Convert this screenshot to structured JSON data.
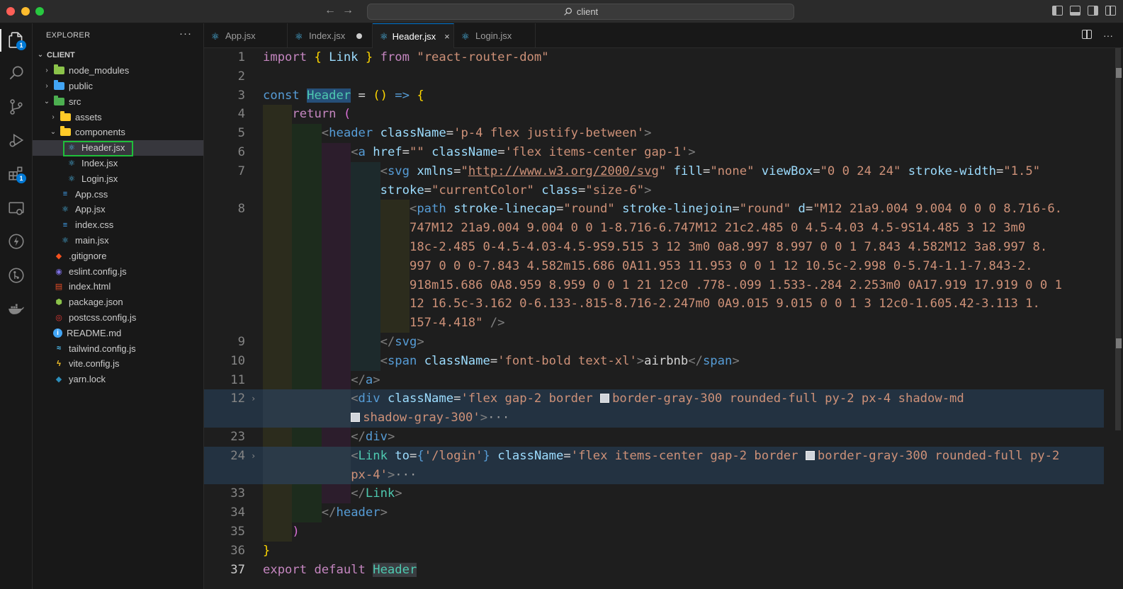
{
  "window": {
    "search_text": "client"
  },
  "sidebar": {
    "title": "EXPLORER",
    "more": "···",
    "root": "CLIENT",
    "items": [
      {
        "name": "node_modules",
        "type": "folder",
        "depth": 1,
        "chevron": "›"
      },
      {
        "name": "public",
        "type": "folder",
        "depth": 1,
        "chevron": "›"
      },
      {
        "name": "src",
        "type": "folder",
        "depth": 1,
        "chevron": "⌄"
      },
      {
        "name": "assets",
        "type": "folder",
        "depth": 2,
        "chevron": "›"
      },
      {
        "name": "components",
        "type": "folder",
        "depth": 2,
        "chevron": "⌄"
      },
      {
        "name": "Header.jsx",
        "type": "react",
        "depth": 3,
        "selected": true
      },
      {
        "name": "Index.jsx",
        "type": "react",
        "depth": 3
      },
      {
        "name": "Login.jsx",
        "type": "react",
        "depth": 3
      },
      {
        "name": "App.css",
        "type": "css",
        "depth": 2
      },
      {
        "name": "App.jsx",
        "type": "react",
        "depth": 2
      },
      {
        "name": "index.css",
        "type": "css",
        "depth": 2
      },
      {
        "name": "main.jsx",
        "type": "react",
        "depth": 2
      },
      {
        "name": ".gitignore",
        "type": "git",
        "depth": 1
      },
      {
        "name": "eslint.config.js",
        "type": "eslint",
        "depth": 1
      },
      {
        "name": "index.html",
        "type": "html",
        "depth": 1
      },
      {
        "name": "package.json",
        "type": "node",
        "depth": 1
      },
      {
        "name": "postcss.config.js",
        "type": "postcss",
        "depth": 1
      },
      {
        "name": "README.md",
        "type": "info",
        "depth": 1
      },
      {
        "name": "tailwind.config.js",
        "type": "tailwind",
        "depth": 1
      },
      {
        "name": "vite.config.js",
        "type": "vite",
        "depth": 1
      },
      {
        "name": "yarn.lock",
        "type": "yarn",
        "depth": 1
      }
    ]
  },
  "activity_badges": {
    "explorer": "1",
    "extensions": "1"
  },
  "tabs": [
    {
      "label": "App.jsx",
      "state": "normal"
    },
    {
      "label": "Index.jsx",
      "state": "modified"
    },
    {
      "label": "Header.jsx",
      "state": "active"
    },
    {
      "label": "Login.jsx",
      "state": "normal"
    }
  ],
  "tab_close_glyph": "×",
  "fold_glyph": "›",
  "code_lines": [
    {
      "n": "1",
      "tokens": [
        [
          "k",
          "import "
        ],
        [
          "br",
          "{ "
        ],
        [
          "v",
          "Link"
        ],
        [
          "br",
          " }"
        ],
        [
          "k",
          " from "
        ],
        [
          "s",
          "\"react-router-dom\""
        ]
      ]
    },
    {
      "n": "2",
      "tokens": []
    },
    {
      "n": "3",
      "tokens": [
        [
          "kb",
          "const "
        ],
        [
          "fn-hl",
          "Header"
        ],
        [
          "d",
          " = "
        ],
        [
          "br",
          "()"
        ],
        [
          "kb",
          " => "
        ],
        [
          "br",
          "{"
        ]
      ]
    },
    {
      "n": "4",
      "tokens": [
        [
          "d",
          "    "
        ],
        [
          "k",
          "return "
        ],
        [
          "br2",
          "("
        ]
      ]
    },
    {
      "n": "5",
      "tokens": [
        [
          "d",
          "        "
        ],
        [
          "p",
          "<"
        ],
        [
          "kb",
          "header "
        ],
        [
          "v",
          "className"
        ],
        [
          "d",
          "="
        ],
        [
          "s",
          "'p-4 flex justify-between'"
        ],
        [
          "p",
          ">"
        ]
      ]
    },
    {
      "n": "6",
      "tokens": [
        [
          "d",
          "            "
        ],
        [
          "p",
          "<"
        ],
        [
          "kb",
          "a "
        ],
        [
          "v",
          "href"
        ],
        [
          "d",
          "="
        ],
        [
          "s",
          "\"\" "
        ],
        [
          "v",
          "className"
        ],
        [
          "d",
          "="
        ],
        [
          "s",
          "'flex items-center gap-1'"
        ],
        [
          "p",
          ">"
        ]
      ]
    },
    {
      "n": "7",
      "tokens": [
        [
          "d",
          "                "
        ],
        [
          "p",
          "<"
        ],
        [
          "kb",
          "svg "
        ],
        [
          "v",
          "xmlns"
        ],
        [
          "d",
          "="
        ],
        [
          "s",
          "\""
        ],
        [
          "url",
          "http://www.w3.org/2000/svg"
        ],
        [
          "s",
          "\" "
        ],
        [
          "v",
          "fill"
        ],
        [
          "d",
          "="
        ],
        [
          "s",
          "\"none\" "
        ],
        [
          "v",
          "viewBox"
        ],
        [
          "d",
          "="
        ],
        [
          "s",
          "\"0 0 24 24\" "
        ],
        [
          "v",
          "stroke-width"
        ],
        [
          "d",
          "="
        ],
        [
          "s",
          "\"1.5\""
        ]
      ]
    },
    {
      "n": "",
      "tokens": [
        [
          "d",
          "                "
        ],
        [
          "v",
          "stroke"
        ],
        [
          "d",
          "="
        ],
        [
          "s",
          "\"currentColor\" "
        ],
        [
          "v",
          "class"
        ],
        [
          "d",
          "="
        ],
        [
          "s",
          "\"size-6\""
        ],
        [
          "p",
          ">"
        ]
      ]
    },
    {
      "n": "8",
      "tokens": [
        [
          "d",
          "                    "
        ],
        [
          "p",
          "<"
        ],
        [
          "kb",
          "path "
        ],
        [
          "v",
          "stroke-linecap"
        ],
        [
          "d",
          "="
        ],
        [
          "s",
          "\"round\" "
        ],
        [
          "v",
          "stroke-linejoin"
        ],
        [
          "d",
          "="
        ],
        [
          "s",
          "\"round\" "
        ],
        [
          "v",
          "d"
        ],
        [
          "d",
          "="
        ],
        [
          "s",
          "\"M12 21a9.004 9.004 0 0 0 8.716-6."
        ]
      ]
    },
    {
      "n": "",
      "tokens": [
        [
          "d",
          "                    "
        ],
        [
          "s",
          "747M12 21a9.004 9.004 0 0 1-8.716-6.747M12 21c2.485 0 4.5-4.03 4.5-9S14.485 3 12 3m0"
        ]
      ]
    },
    {
      "n": "",
      "tokens": [
        [
          "d",
          "                    "
        ],
        [
          "s",
          "18c-2.485 0-4.5-4.03-4.5-9S9.515 3 12 3m0 0a8.997 8.997 0 0 1 7.843 4.582M12 3a8.997 8."
        ]
      ]
    },
    {
      "n": "",
      "tokens": [
        [
          "d",
          "                    "
        ],
        [
          "s",
          "997 0 0 0-7.843 4.582m15.686 0A11.953 11.953 0 0 1 12 10.5c-2.998 0-5.74-1.1-7.843-2."
        ]
      ]
    },
    {
      "n": "",
      "tokens": [
        [
          "d",
          "                    "
        ],
        [
          "s",
          "918m15.686 0A8.959 8.959 0 0 1 21 12c0 .778-.099 1.533-.284 2.253m0 0A17.919 17.919 0 0 1"
        ]
      ]
    },
    {
      "n": "",
      "tokens": [
        [
          "d",
          "                    "
        ],
        [
          "s",
          "12 16.5c-3.162 0-6.133-.815-8.716-2.247m0 0A9.015 9.015 0 0 1 3 12c0-1.605.42-3.113 1."
        ]
      ]
    },
    {
      "n": "",
      "tokens": [
        [
          "d",
          "                    "
        ],
        [
          "s",
          "157-4.418\" "
        ],
        [
          "p",
          "/>"
        ]
      ]
    },
    {
      "n": "9",
      "tokens": [
        [
          "d",
          "                "
        ],
        [
          "p",
          "</"
        ],
        [
          "kb",
          "svg"
        ],
        [
          "p",
          ">"
        ]
      ]
    },
    {
      "n": "10",
      "tokens": [
        [
          "d",
          "                "
        ],
        [
          "p",
          "<"
        ],
        [
          "kb",
          "span "
        ],
        [
          "v",
          "className"
        ],
        [
          "d",
          "="
        ],
        [
          "s",
          "'font-bold text-xl'"
        ],
        [
          "p",
          ">"
        ],
        [
          "d",
          "airbnb"
        ],
        [
          "p",
          "</"
        ],
        [
          "kb",
          "span"
        ],
        [
          "p",
          ">"
        ]
      ]
    },
    {
      "n": "11",
      "tokens": [
        [
          "d",
          "            "
        ],
        [
          "p",
          "</"
        ],
        [
          "kb",
          "a"
        ],
        [
          "p",
          ">"
        ]
      ]
    },
    {
      "n": "12",
      "fold": true,
      "hl": true,
      "tokens": [
        [
          "d",
          "            "
        ],
        [
          "p",
          "<"
        ],
        [
          "kb",
          "div "
        ],
        [
          "v",
          "className"
        ],
        [
          "d",
          "="
        ],
        [
          "s",
          "'flex gap-2 border "
        ],
        [
          "sq",
          ""
        ],
        [
          "s",
          "border-gray-300 rounded-full py-2 px-4 shadow-md"
        ]
      ]
    },
    {
      "n": "",
      "hl": true,
      "tokens": [
        [
          "d",
          "            "
        ],
        [
          "sq",
          ""
        ],
        [
          "s",
          "shadow-gray-300'"
        ],
        [
          "p",
          ">"
        ],
        [
          "e",
          "···"
        ]
      ]
    },
    {
      "n": "23",
      "tokens": [
        [
          "d",
          "            "
        ],
        [
          "p",
          "</"
        ],
        [
          "kb",
          "div"
        ],
        [
          "p",
          ">"
        ]
      ]
    },
    {
      "n": "24",
      "fold": true,
      "hl": true,
      "tokens": [
        [
          "d",
          "            "
        ],
        [
          "p",
          "<"
        ],
        [
          "t",
          "Link "
        ],
        [
          "v",
          "to"
        ],
        [
          "d",
          "="
        ],
        [
          "kb",
          "{"
        ],
        [
          "s",
          "'/login'"
        ],
        [
          "kb",
          "} "
        ],
        [
          "v",
          "className"
        ],
        [
          "d",
          "="
        ],
        [
          "s",
          "'flex items-center gap-2 border "
        ],
        [
          "sq",
          ""
        ],
        [
          "s",
          "border-gray-300 rounded-full py-2"
        ]
      ]
    },
    {
      "n": "",
      "hl": true,
      "tokens": [
        [
          "d",
          "            "
        ],
        [
          "s",
          "px-4'"
        ],
        [
          "p",
          ">"
        ],
        [
          "e",
          "···"
        ]
      ]
    },
    {
      "n": "33",
      "tokens": [
        [
          "d",
          "            "
        ],
        [
          "p",
          "</"
        ],
        [
          "t",
          "Link"
        ],
        [
          "p",
          ">"
        ]
      ]
    },
    {
      "n": "34",
      "tokens": [
        [
          "d",
          "        "
        ],
        [
          "p",
          "</"
        ],
        [
          "kb",
          "header"
        ],
        [
          "p",
          ">"
        ]
      ]
    },
    {
      "n": "35",
      "tokens": [
        [
          "d",
          "    "
        ],
        [
          "br2",
          ")"
        ]
      ]
    },
    {
      "n": "36",
      "tokens": [
        [
          "br",
          "}"
        ]
      ]
    },
    {
      "n": "37",
      "cur": true,
      "tokens": [
        [
          "k",
          "export "
        ],
        [
          "k",
          "default "
        ],
        [
          "fn-hl2",
          "Header"
        ]
      ]
    }
  ],
  "colors": {
    "selected_outline": "#1fbf3a",
    "accent": "#0078d4"
  }
}
